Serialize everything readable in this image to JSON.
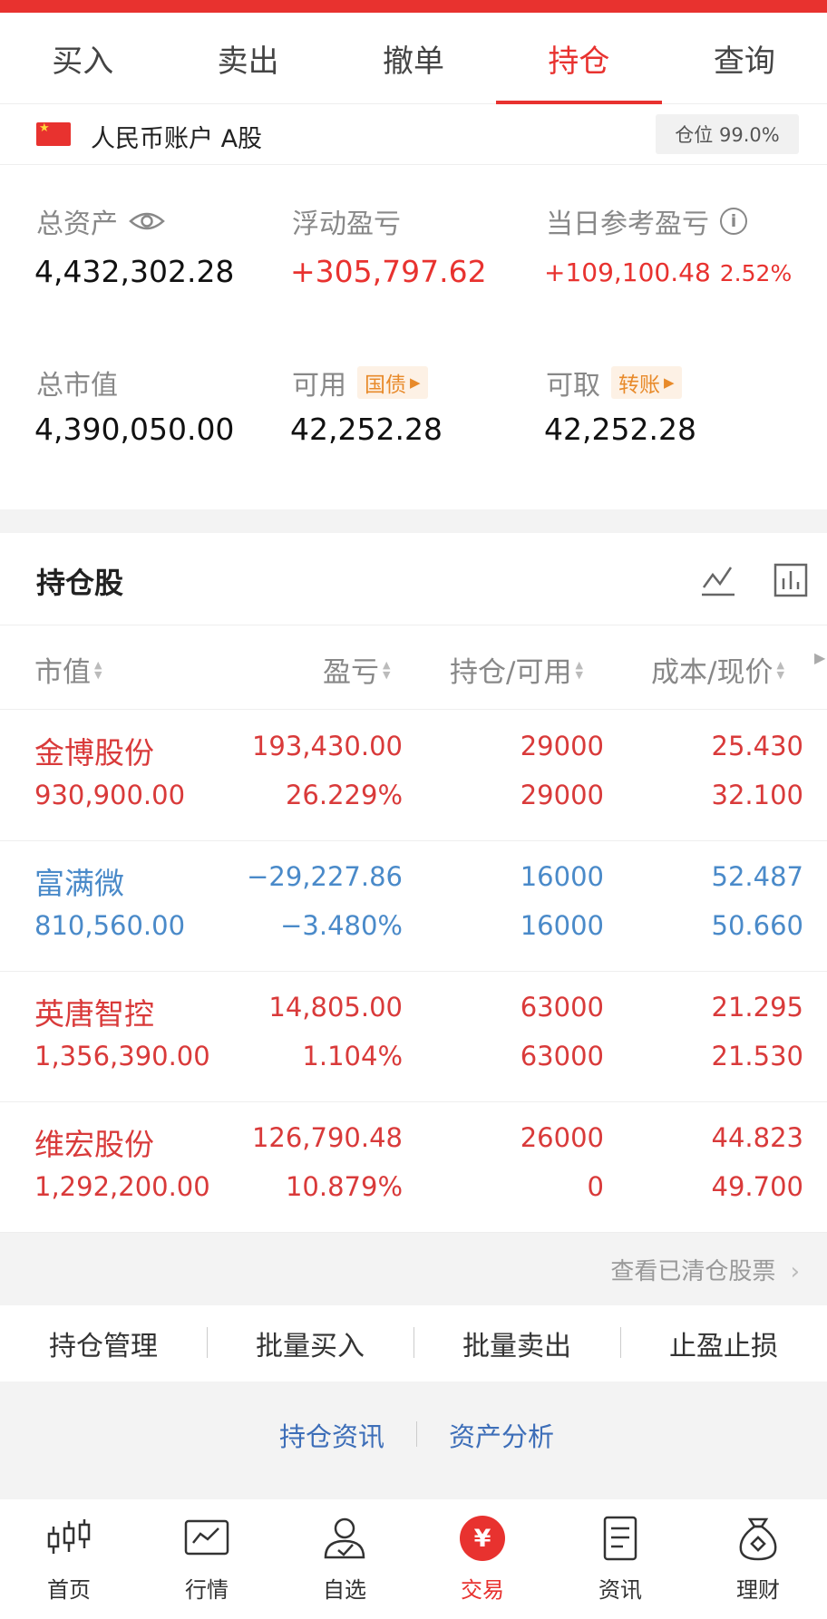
{
  "tabs": [
    {
      "label": "买入"
    },
    {
      "label": "卖出"
    },
    {
      "label": "撤单"
    },
    {
      "label": "持仓",
      "active": true
    },
    {
      "label": "查询"
    }
  ],
  "account": {
    "name": "人民币账户 A股",
    "position_label": "仓位 99.0%"
  },
  "metrics": {
    "total_assets_label": "总资产",
    "total_assets": "4,432,302.28",
    "floating_pl_label": "浮动盈亏",
    "floating_pl": "+305,797.62",
    "daily_pl_label": "当日参考盈亏",
    "daily_pl": "+109,100.48",
    "daily_pl_pct": "2.52%",
    "market_value_label": "总市值",
    "market_value": "4,390,050.00",
    "available_label": "可用",
    "available_tag": "国债",
    "available": "42,252.28",
    "withdrawable_label": "可取",
    "withdrawable_tag": "转账",
    "withdrawable": "42,252.28"
  },
  "holdings": {
    "title": "持仓股",
    "columns": [
      "市值",
      "盈亏",
      "持仓/可用",
      "成本/现价"
    ],
    "rows": [
      {
        "name": "金博股份",
        "market_value": "930,900.00",
        "pl": "193,430.00",
        "pl_pct": "26.229%",
        "position": "29000",
        "available": "29000",
        "cost": "25.430",
        "price": "32.100",
        "trend": "up"
      },
      {
        "name": "富满微",
        "market_value": "810,560.00",
        "pl": "−29,227.86",
        "pl_pct": "−3.480%",
        "position": "16000",
        "available": "16000",
        "cost": "52.487",
        "price": "50.660",
        "trend": "down"
      },
      {
        "name": "英唐智控",
        "market_value": "1,356,390.00",
        "pl": "14,805.00",
        "pl_pct": "1.104%",
        "position": "63000",
        "available": "63000",
        "cost": "21.295",
        "price": "21.530",
        "trend": "up"
      },
      {
        "name": "维宏股份",
        "market_value": "1,292,200.00",
        "pl": "126,790.48",
        "pl_pct": "10.879%",
        "position": "26000",
        "available": "0",
        "cost": "44.823",
        "price": "49.700",
        "trend": "up"
      }
    ]
  },
  "cleared_link": "查看已清仓股票",
  "actions": [
    "持仓管理",
    "批量买入",
    "批量卖出",
    "止盈止损"
  ],
  "links": [
    "持仓资讯",
    "资产分析"
  ],
  "bottom_nav": [
    {
      "label": "首页",
      "icon": "candlestick-icon"
    },
    {
      "label": "行情",
      "icon": "chart-icon"
    },
    {
      "label": "自选",
      "icon": "user-check-icon"
    },
    {
      "label": "交易",
      "icon": "yen-icon",
      "active": true
    },
    {
      "label": "资讯",
      "icon": "document-icon"
    },
    {
      "label": "理财",
      "icon": "money-bag-icon"
    }
  ],
  "colors": {
    "accent": "#e8322f",
    "up": "#d93a3a",
    "down": "#4a8ac9",
    "link": "#3d6eb8"
  }
}
